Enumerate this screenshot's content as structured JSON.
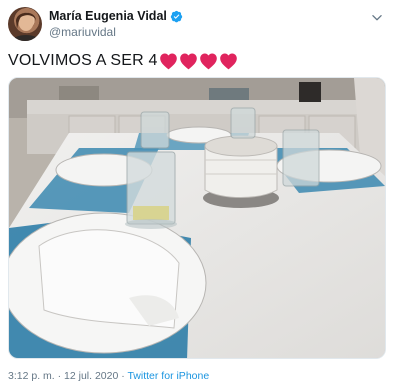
{
  "tweet": {
    "author_name": "María Eugenia Vidal",
    "author_handle": "@mariuvidal",
    "text": "VOLVIMOS A SER 4",
    "emoji_hearts": 4,
    "timestamp": "3:12 p. m. · 12 jul. 2020 · ",
    "source": "Twitter for iPhone"
  },
  "icons": {
    "verified": "verified-badge-icon",
    "menu": "chevron-down-icon",
    "heart": "red-heart-emoji"
  },
  "colors": {
    "verified_blue": "#1da1f2",
    "heart_red": "#e0245e",
    "link_blue": "#1b95e0",
    "muted_gray": "#657786"
  }
}
